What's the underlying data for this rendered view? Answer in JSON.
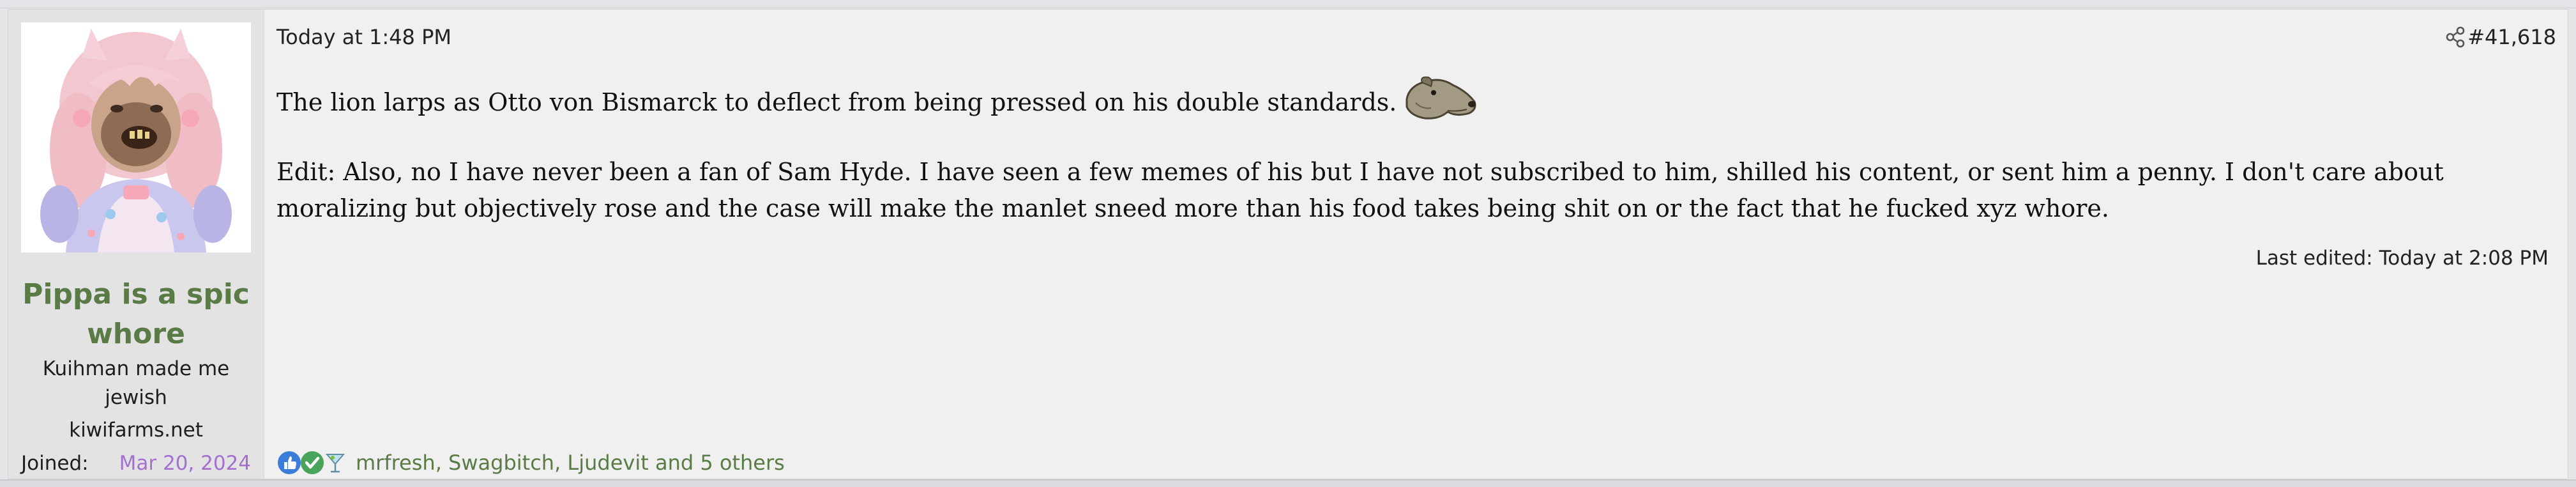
{
  "user": {
    "name": "Pippa is a spic whore",
    "title": "Kuihman made me jewish",
    "site": "kiwifarms.net",
    "joined_label": "Joined:",
    "joined_date": "Mar 20, 2024"
  },
  "post": {
    "date": "Today at 1:48 PM",
    "number": "#41,618",
    "paragraph1": "The lion larps as Otto von Bismarck to deflect from being pressed on his double standards.",
    "paragraph2": "Edit: Also, no I have never been a fan of Sam Hyde. I have seen a few memes of his but I have not subscribed to him, shilled his content, or sent him a penny. I don't care about moralizing but objectively rose and the case will make the manlet sneed more than his food takes being shit on or the fact that he fucked xyz whore.",
    "last_edited": "Last edited: Today at 2:08 PM"
  },
  "reactions": {
    "icons": [
      "thumbs-up-icon",
      "checkmark-icon",
      "martini-icon"
    ],
    "users_text": "mrfresh, Swagbitch, Ljudevit and 5 others"
  },
  "colors": {
    "username": "#5a7b45",
    "joined_date": "#a56fd0",
    "reactions_link": "#5a7b45",
    "post_bg": "#f0f0f0",
    "user_cell_bg": "#e3e3e3"
  }
}
